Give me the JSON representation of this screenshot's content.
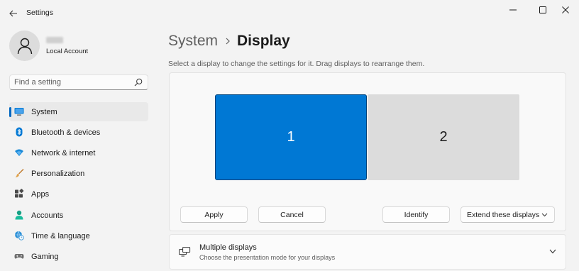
{
  "app": {
    "title": "Settings"
  },
  "window_controls": {
    "minimize": "minimize-icon",
    "maximize": "maximize-icon",
    "close": "close-icon"
  },
  "profile": {
    "account_type": "Local Account"
  },
  "search": {
    "placeholder": "Find a setting",
    "value": ""
  },
  "sidebar": {
    "items": [
      {
        "label": "System",
        "icon": "monitor-icon",
        "active": true
      },
      {
        "label": "Bluetooth & devices",
        "icon": "bluetooth-icon",
        "active": false
      },
      {
        "label": "Network & internet",
        "icon": "wifi-icon",
        "active": false
      },
      {
        "label": "Personalization",
        "icon": "brush-icon",
        "active": false
      },
      {
        "label": "Apps",
        "icon": "apps-icon",
        "active": false
      },
      {
        "label": "Accounts",
        "icon": "person-icon",
        "active": false
      },
      {
        "label": "Time & language",
        "icon": "globe-clock-icon",
        "active": false
      },
      {
        "label": "Gaming",
        "icon": "gamepad-icon",
        "active": false
      }
    ]
  },
  "breadcrumb": {
    "parent": "System",
    "current": "Display"
  },
  "instructions": "Select a display to change the settings for it. Drag displays to rearrange them.",
  "displays": {
    "monitors": [
      {
        "number": "1",
        "selected": true
      },
      {
        "number": "2",
        "selected": false
      }
    ],
    "apply_label": "Apply",
    "cancel_label": "Cancel",
    "identify_label": "Identify",
    "mode_selected": "Extend these displays"
  },
  "multiple_displays": {
    "title": "Multiple displays",
    "subtitle": "Choose the presentation mode for your displays",
    "icon": "multiple-displays-icon"
  },
  "colors": {
    "accent": "#0078d4",
    "indicator": "#0067c0",
    "secondary_monitor": "#dcdcdc"
  }
}
